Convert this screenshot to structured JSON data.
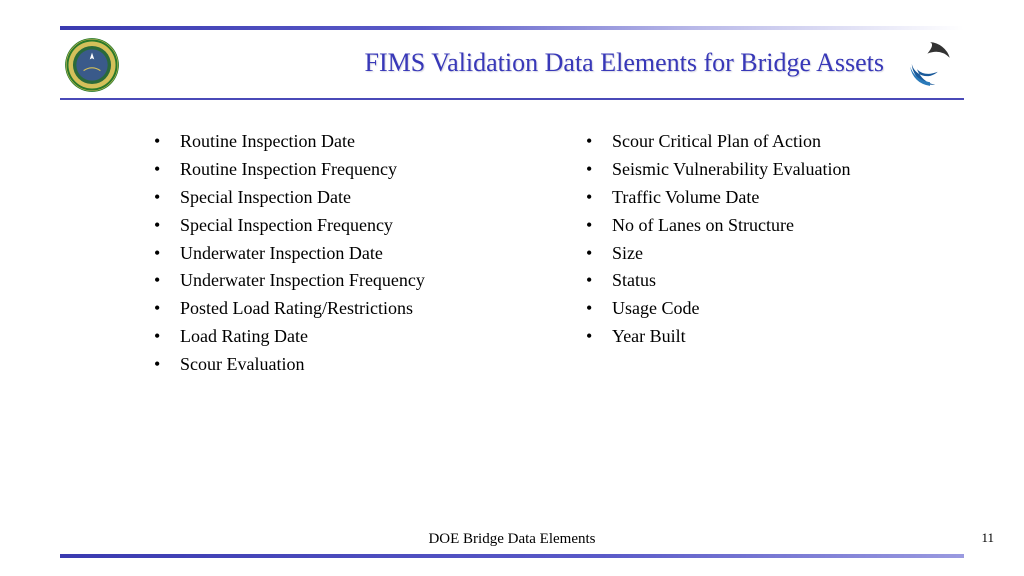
{
  "header": {
    "title": "FIMS Validation Data Elements for Bridge Assets"
  },
  "columns": {
    "left": [
      "Routine Inspection Date",
      "Routine Inspection Frequency",
      "Special Inspection Date",
      "Special Inspection Frequency",
      "Underwater Inspection Date",
      "Underwater Inspection Frequency",
      "Posted Load Rating/Restrictions",
      "Load Rating Date",
      "Scour Evaluation"
    ],
    "right": [
      "Scour Critical Plan of Action",
      "Seismic Vulnerability Evaluation",
      "Traffic Volume Date",
      "No of Lanes on Structure",
      "Size",
      "Status",
      "Usage Code",
      "Year Built"
    ]
  },
  "footer": {
    "label": "DOE Bridge Data Elements",
    "page": "11"
  }
}
